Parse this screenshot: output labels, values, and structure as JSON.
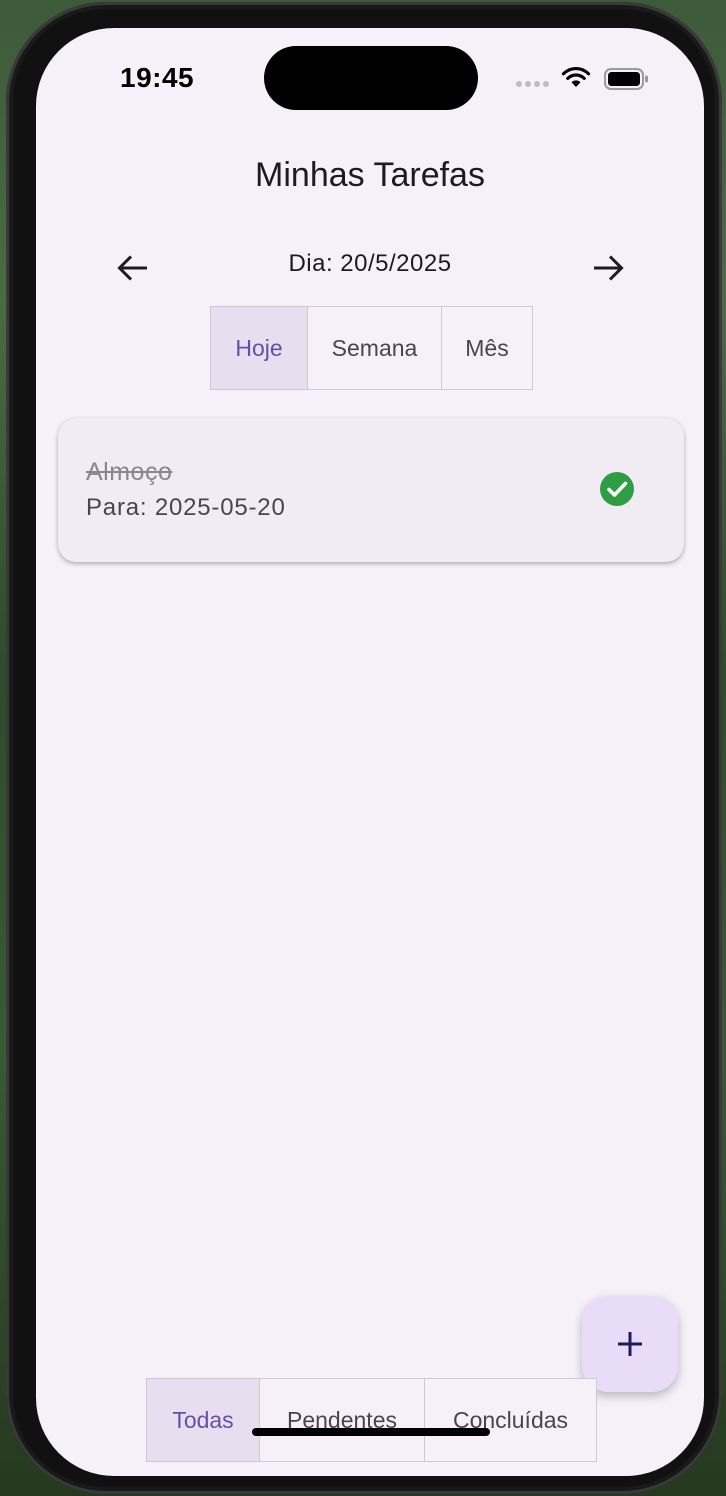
{
  "status_bar": {
    "time": "19:45"
  },
  "header": {
    "title": "Minhas Tarefas"
  },
  "date_nav": {
    "label": "Dia: 20/5/2025",
    "prev_icon": "arrow-left-icon",
    "next_icon": "arrow-right-icon"
  },
  "period_filter": {
    "options": [
      "Hoje",
      "Semana",
      "Mês"
    ],
    "selected": "Hoje"
  },
  "tasks": [
    {
      "title": "Almoço",
      "subtitle": "Para: 2025-05-20",
      "completed": true,
      "status_icon": "check-circle-icon"
    }
  ],
  "fab": {
    "icon": "plus-icon"
  },
  "status_filter": {
    "options": [
      "Todas",
      "Pendentes",
      "Concluídas"
    ],
    "selected": "Todas"
  },
  "colors": {
    "background": "#f6f1f8",
    "accent": "#6750a4",
    "selected_segment": "#e7dff0",
    "success": "#2e9d44",
    "fab": "#e9dcf9"
  }
}
